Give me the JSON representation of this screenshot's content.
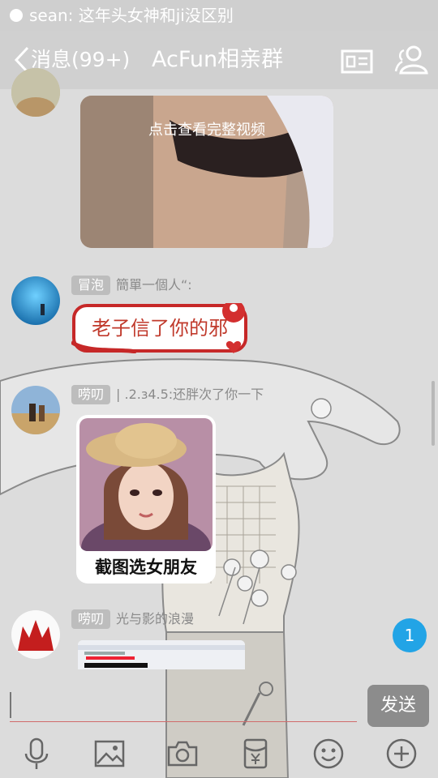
{
  "status": {
    "notification": "sean: 这年头女神和ji没区别"
  },
  "header": {
    "back_label": "消息(99+)",
    "title": "AcFun相亲群"
  },
  "messages": [
    {
      "type": "video",
      "hint": "点击查看完整视频"
    },
    {
      "type": "sticker",
      "tag": "冒泡",
      "sender": "簡單一個人“:",
      "text": "老子信了你的邪"
    },
    {
      "type": "image",
      "tag": "唠叨",
      "sender": "|  .2.ɜ4.5:还胖次了你一下",
      "caption": "截图选女朋友"
    },
    {
      "type": "image",
      "tag": "唠叨",
      "sender": "光与影的浪漫"
    }
  ],
  "unread_count": "1",
  "input": {
    "send_label": "发送"
  },
  "toolbar": [
    "mic-icon",
    "image-icon",
    "camera-icon",
    "red-packet-icon",
    "emoji-icon",
    "plus-icon"
  ],
  "colors": {
    "badge": "#22a4e6",
    "sticker_text": "#c0392b",
    "tag": "#bdbdbd"
  }
}
